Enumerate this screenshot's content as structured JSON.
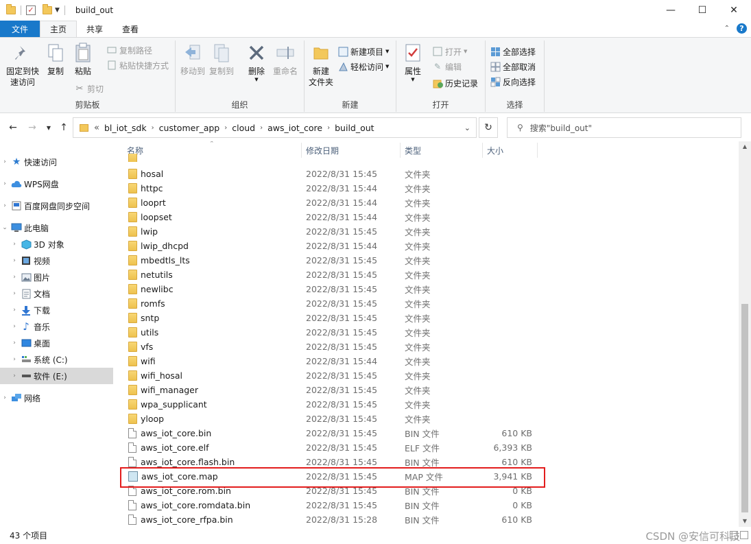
{
  "window": {
    "title": "build_out",
    "controls": {
      "minimize": "—",
      "maximize": "☐",
      "close": "✕"
    }
  },
  "ribbon_tabs": {
    "file": "文件",
    "home": "主页",
    "share": "共享",
    "view": "查看"
  },
  "ribbon": {
    "clipboard": {
      "label": "剪贴板",
      "pin": "固定到快\n速访问",
      "copy": "复制",
      "paste": "粘贴",
      "copy_path": "复制路径",
      "paste_shortcut": "粘贴快捷方式",
      "cut": "剪切"
    },
    "organize": {
      "label": "组织",
      "move_to": "移动到",
      "copy_to": "复制到",
      "delete": "删除",
      "rename": "重命名"
    },
    "new": {
      "label": "新建",
      "new_folder": "新建\n文件夹",
      "new_item": "新建项目",
      "easy_access": "轻松访问"
    },
    "open": {
      "label": "打开",
      "properties": "属性",
      "open": "打开",
      "edit": "编辑",
      "history": "历史记录"
    },
    "select": {
      "label": "选择",
      "select_all": "全部选择",
      "select_none": "全部取消",
      "invert": "反向选择"
    }
  },
  "address": {
    "prefix": "«",
    "crumbs": [
      "bl_iot_sdk",
      "customer_app",
      "cloud",
      "aws_iot_core",
      "build_out"
    ],
    "search_placeholder": "搜索\"build_out\""
  },
  "sidebar": {
    "items": [
      {
        "label": "快速访问",
        "icon": "star-icon"
      },
      {
        "label": "WPS网盘",
        "icon": "cloud-icon"
      },
      {
        "label": "百度网盘同步空间",
        "icon": "baidu-sync-icon"
      },
      {
        "label": "此电脑",
        "icon": "computer-icon"
      },
      {
        "label": "3D 对象",
        "icon": "cube-icon"
      },
      {
        "label": "视频",
        "icon": "video-icon"
      },
      {
        "label": "图片",
        "icon": "picture-icon"
      },
      {
        "label": "文档",
        "icon": "document-icon"
      },
      {
        "label": "下载",
        "icon": "download-icon"
      },
      {
        "label": "音乐",
        "icon": "music-icon"
      },
      {
        "label": "桌面",
        "icon": "desktop-icon"
      },
      {
        "label": "系统 (C:)",
        "icon": "drive-c-icon"
      },
      {
        "label": "软件 (E:)",
        "icon": "drive-e-icon"
      },
      {
        "label": "网络",
        "icon": "network-icon"
      }
    ]
  },
  "columns": {
    "name": "名称",
    "date": "修改日期",
    "type": "类型",
    "size": "大小"
  },
  "files": [
    {
      "name": "hosal",
      "date": "2022/8/31 15:45",
      "type": "文件夹",
      "size": "",
      "kind": "folder"
    },
    {
      "name": "httpc",
      "date": "2022/8/31 15:44",
      "type": "文件夹",
      "size": "",
      "kind": "folder"
    },
    {
      "name": "looprt",
      "date": "2022/8/31 15:44",
      "type": "文件夹",
      "size": "",
      "kind": "folder"
    },
    {
      "name": "loopset",
      "date": "2022/8/31 15:44",
      "type": "文件夹",
      "size": "",
      "kind": "folder"
    },
    {
      "name": "lwip",
      "date": "2022/8/31 15:45",
      "type": "文件夹",
      "size": "",
      "kind": "folder"
    },
    {
      "name": "lwip_dhcpd",
      "date": "2022/8/31 15:44",
      "type": "文件夹",
      "size": "",
      "kind": "folder"
    },
    {
      "name": "mbedtls_lts",
      "date": "2022/8/31 15:45",
      "type": "文件夹",
      "size": "",
      "kind": "folder"
    },
    {
      "name": "netutils",
      "date": "2022/8/31 15:45",
      "type": "文件夹",
      "size": "",
      "kind": "folder"
    },
    {
      "name": "newlibc",
      "date": "2022/8/31 15:45",
      "type": "文件夹",
      "size": "",
      "kind": "folder"
    },
    {
      "name": "romfs",
      "date": "2022/8/31 15:45",
      "type": "文件夹",
      "size": "",
      "kind": "folder"
    },
    {
      "name": "sntp",
      "date": "2022/8/31 15:45",
      "type": "文件夹",
      "size": "",
      "kind": "folder"
    },
    {
      "name": "utils",
      "date": "2022/8/31 15:45",
      "type": "文件夹",
      "size": "",
      "kind": "folder"
    },
    {
      "name": "vfs",
      "date": "2022/8/31 15:45",
      "type": "文件夹",
      "size": "",
      "kind": "folder"
    },
    {
      "name": "wifi",
      "date": "2022/8/31 15:44",
      "type": "文件夹",
      "size": "",
      "kind": "folder"
    },
    {
      "name": "wifi_hosal",
      "date": "2022/8/31 15:45",
      "type": "文件夹",
      "size": "",
      "kind": "folder"
    },
    {
      "name": "wifi_manager",
      "date": "2022/8/31 15:45",
      "type": "文件夹",
      "size": "",
      "kind": "folder"
    },
    {
      "name": "wpa_supplicant",
      "date": "2022/8/31 15:45",
      "type": "文件夹",
      "size": "",
      "kind": "folder"
    },
    {
      "name": "yloop",
      "date": "2022/8/31 15:45",
      "type": "文件夹",
      "size": "",
      "kind": "folder"
    },
    {
      "name": "aws_iot_core.bin",
      "date": "2022/8/31 15:45",
      "type": "BIN 文件",
      "size": "610 KB",
      "kind": "file"
    },
    {
      "name": "aws_iot_core.elf",
      "date": "2022/8/31 15:45",
      "type": "ELF 文件",
      "size": "6,393 KB",
      "kind": "file"
    },
    {
      "name": "aws_iot_core.flash.bin",
      "date": "2022/8/31 15:45",
      "type": "BIN 文件",
      "size": "610 KB",
      "kind": "file"
    },
    {
      "name": "aws_iot_core.map",
      "date": "2022/8/31 15:45",
      "type": "MAP 文件",
      "size": "3,941 KB",
      "kind": "map"
    },
    {
      "name": "aws_iot_core.rom.bin",
      "date": "2022/8/31 15:45",
      "type": "BIN 文件",
      "size": "0 KB",
      "kind": "file"
    },
    {
      "name": "aws_iot_core.romdata.bin",
      "date": "2022/8/31 15:45",
      "type": "BIN 文件",
      "size": "0 KB",
      "kind": "file"
    },
    {
      "name": "aws_iot_core_rfpa.bin",
      "date": "2022/8/31 15:28",
      "type": "BIN 文件",
      "size": "610 KB",
      "kind": "file"
    }
  ],
  "status": {
    "count": "43 个项目",
    "watermark": "CSDN @安信可科技"
  },
  "colors": {
    "accent": "#1979ca",
    "highlight": "#e31c1c",
    "folder": "#f3c85b",
    "selected": "#d9d9d9"
  }
}
